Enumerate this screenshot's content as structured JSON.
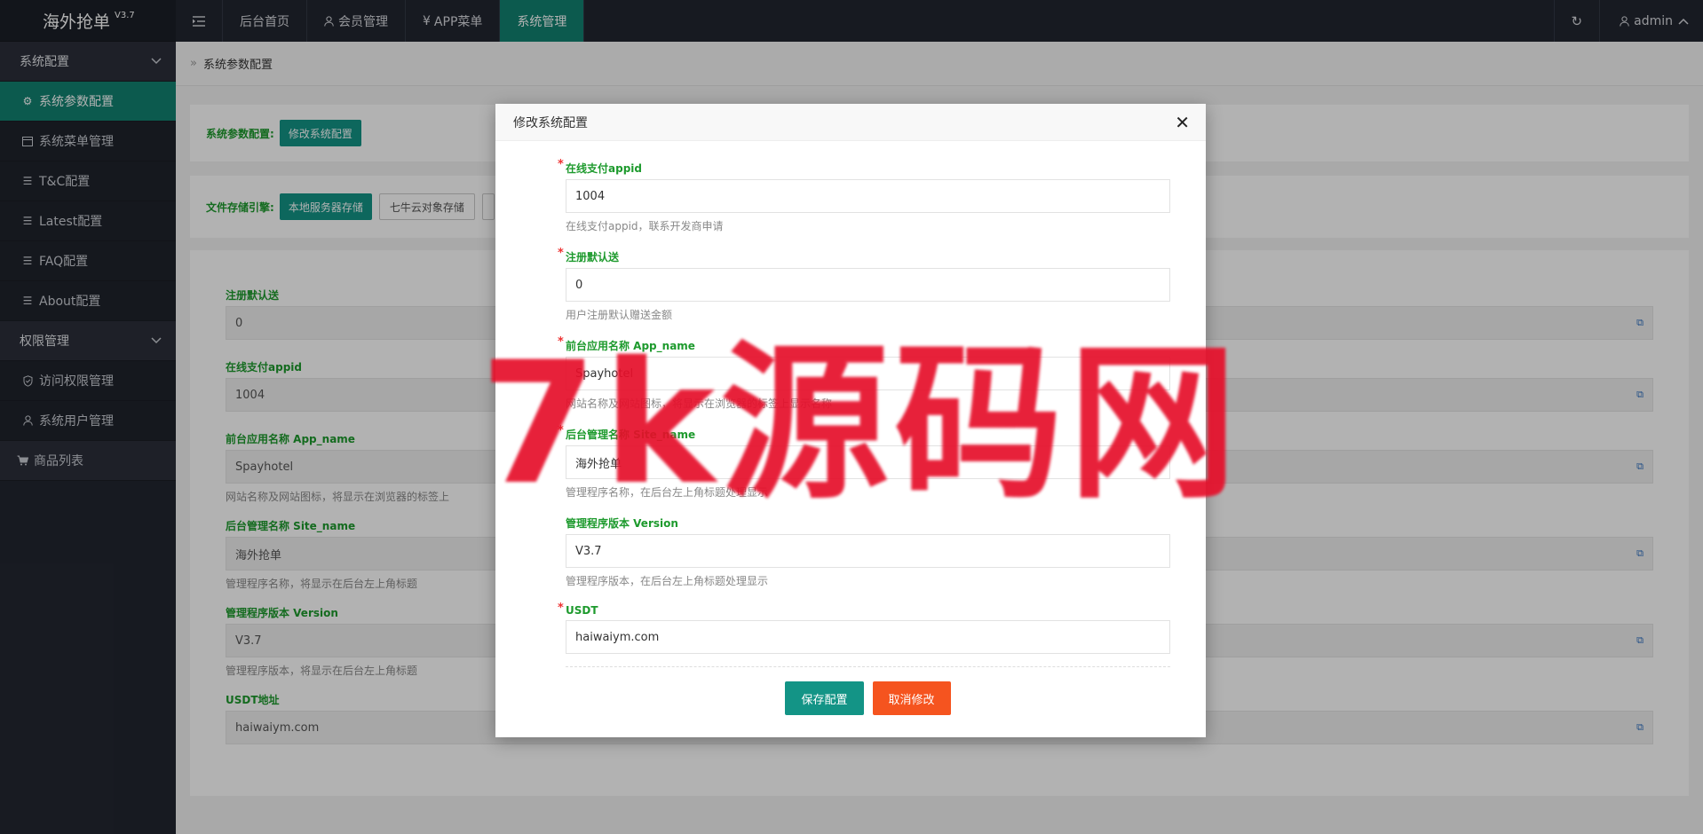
{
  "brand": {
    "title": "海外抢单",
    "version": "V3.7"
  },
  "sidebar": {
    "groups": [
      {
        "label": "系统配置",
        "items": [
          "系统参数配置",
          "系统菜单管理",
          "T&C配置",
          "Latest配置",
          "FAQ配置",
          "About配置"
        ]
      },
      {
        "label": "权限管理",
        "items": [
          "访问权限管理",
          "系统用户管理"
        ]
      }
    ],
    "top_item": "商品列表"
  },
  "topbar": {
    "tabs": [
      "后台首页",
      "会员管理",
      "APP菜单",
      "系统管理"
    ],
    "user": "admin"
  },
  "breadcrumb": "系统参数配置",
  "page": {
    "params_label": "系统参数配置:",
    "edit_button": "修改系统配置",
    "storage_label": "文件存储引擎:",
    "storage_options": [
      "本地服务器存储",
      "七牛云对象存储"
    ],
    "fields": [
      {
        "label": "注册默认送",
        "value": "0",
        "help": ""
      },
      {
        "label": "在线支付appid",
        "value": "1004",
        "help": ""
      },
      {
        "label": "前台应用名称 App_name",
        "value": "Spayhotel",
        "help": "网站名称及网站图标，将显示在浏览器的标签上"
      },
      {
        "label": "后台管理名称 Site_name",
        "value": "海外抢单",
        "help": "管理程序名称，将显示在后台左上角标题"
      },
      {
        "label": "管理程序版本 Version",
        "value": "V3.7",
        "help": "管理程序版本，将显示在后台左上角标题"
      },
      {
        "label": "USDT地址",
        "value": "haiwaiym.com",
        "help": ""
      }
    ]
  },
  "modal": {
    "title": "修改系统配置",
    "fields": [
      {
        "label": "在线支付appid",
        "value": "1004",
        "help": "在线支付appid，联系开发商申请"
      },
      {
        "label": "注册默认送",
        "value": "0",
        "help": "用户注册默认赠送金额"
      },
      {
        "label": "前台应用名称 App_name",
        "value": "Spayhotel",
        "help": "网站名称及网站图标，将显示在浏览器的标签上显示名称"
      },
      {
        "label": "后台管理名称 Site_name",
        "value": "海外抢单",
        "help": "管理程序名称，在后台左上角标题处理显示"
      },
      {
        "label": "管理程序版本 Version",
        "value": "V3.7",
        "help": "管理程序版本，在后台左上角标题处理显示"
      },
      {
        "label": "USDT",
        "value": "haiwaiym.com",
        "help": ""
      }
    ],
    "save_label": "保存配置",
    "cancel_label": "取消修改"
  },
  "watermark": "7k源码网",
  "colors": {
    "accent": "#128170",
    "danger": "#f5541f",
    "label_green": "#1d9a2d",
    "sidebar_bg": "#222630"
  }
}
